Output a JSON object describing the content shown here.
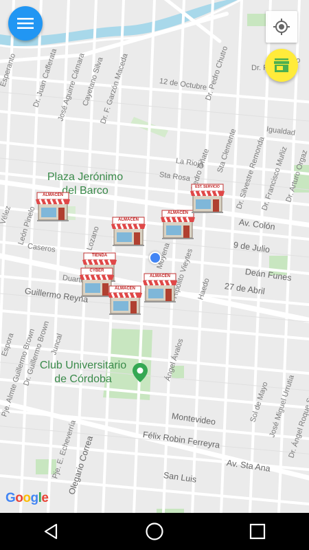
{
  "map": {
    "poi": [
      {
        "name": "Plaza Jerónimo del Barco",
        "line1": "Plaza Jerónimo",
        "line2": "del Barco"
      },
      {
        "name": "Club Universitario de Córdoba",
        "line1": "Club Universitario",
        "line2": "de Córdoba"
      }
    ],
    "streets": [
      "Esperanto",
      "Dr. Juan Cafferata",
      "José Aguirre Cámara",
      "Cayetano Silva",
      "Dr. F. Garzón Maceda",
      "12 de Octubre",
      "Dr. Pedro Chutro",
      "Pedro",
      "Dr. Pedro",
      "Igualdad",
      "La Rioja",
      "Sta Rosa",
      "Av. Colón",
      "9 de Julio",
      "Deán Funes",
      "27 de Abril",
      "Caseros",
      "Duarte",
      "Guillermo Reyna",
      "Vélez",
      "León Pinelo",
      "Lozano",
      "Juncal",
      "Dr. Guillermo Brown",
      "Espora",
      "Pje. Almte Guillermo Brown",
      "Moyena",
      "Hipólito Vieytes",
      "Haedo",
      "Pedro Oñate",
      "Sta Clemente",
      "Dr. Silvestre Remonda",
      "Dr. Francisco Muñiz",
      "Dr. Arturo Orgaz",
      "Ángel Ávalos",
      "Montevideo",
      "Félix Robin Ferreyra",
      "Av. Sta Ana",
      "San Luis",
      "Pje. E. Echeverría",
      "Olegario Correa",
      "Sol de Mayo",
      "José Miguel Urrutia",
      "Dr. Ángel Roque Suárez"
    ],
    "stores": [
      {
        "label": "ALMACEN"
      },
      {
        "label": "ALMACEN"
      },
      {
        "label": "ALMACEN"
      },
      {
        "label": "EST. SERVICIO"
      },
      {
        "label": "TIENDA"
      },
      {
        "label": "CYBER"
      },
      {
        "label": "ALMACEN"
      },
      {
        "label": "ALMACEN"
      }
    ],
    "attribution": "Google",
    "colors": {
      "park": "#c8e6c0",
      "road": "#ffffff",
      "river": "#a8d8ea",
      "accent": "#2196f3",
      "fab": "#ffeb3b"
    }
  },
  "controls": {
    "menu_icon": "hamburger-menu-icon",
    "location_icon": "my-location-icon",
    "store_icon": "store-icon"
  },
  "navbar": {
    "icons": [
      "back-triangle-icon",
      "home-circle-icon",
      "recents-square-icon"
    ]
  }
}
